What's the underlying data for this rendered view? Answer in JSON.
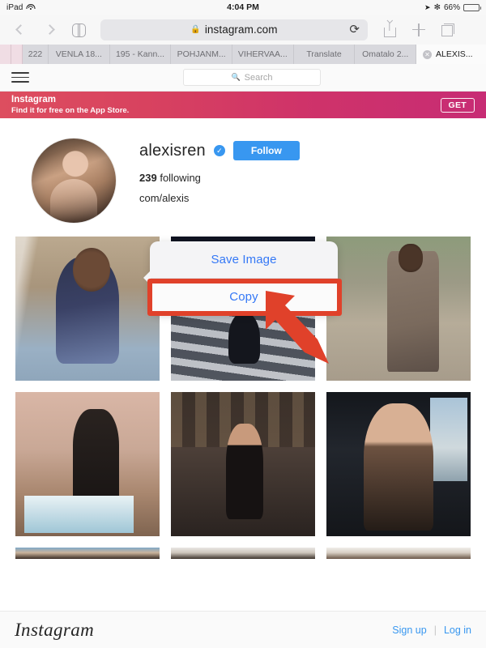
{
  "status_bar": {
    "device": "iPad",
    "wifi_icon": "wifi-icon",
    "time": "4:04 PM",
    "location_icon": "location-arrow-icon",
    "bluetooth_icon": "bluetooth-icon",
    "battery_percent": "66%",
    "battery_icon": "battery-icon"
  },
  "browser": {
    "back_icon": "chevron-left-icon",
    "forward_icon": "chevron-right-icon",
    "bookmarks_icon": "book-icon",
    "lock_icon": "lock-icon",
    "url": "instagram.com",
    "reload_icon": "reload-icon",
    "share_icon": "share-icon",
    "new_tab_icon": "plus-icon",
    "tabs_icon": "tabs-overview-icon",
    "tabs": [
      {
        "label": "222",
        "active": false,
        "style": "narrow"
      },
      {
        "label": "VENLA 18...",
        "active": false,
        "style": "normal"
      },
      {
        "label": "195 - Kann...",
        "active": false,
        "style": "normal"
      },
      {
        "label": "POHJANM...",
        "active": false,
        "style": "normal"
      },
      {
        "label": "VIHERVAA...",
        "active": false,
        "style": "normal"
      },
      {
        "label": "Translate",
        "active": false,
        "style": "normal"
      },
      {
        "label": "Omatalo 2...",
        "active": false,
        "style": "normal"
      },
      {
        "label": "ALEXIS...",
        "active": true,
        "style": "normal",
        "close_icon": "close-icon"
      }
    ]
  },
  "instagram_header": {
    "menu_icon": "hamburger-menu-icon",
    "search_icon": "search-icon",
    "search_placeholder": "Search"
  },
  "app_banner": {
    "title": "Instagram",
    "subtitle": "Find it for free on the App Store.",
    "cta_label": "GET"
  },
  "profile": {
    "avatar_name": "profile-avatar",
    "username": "alexisren",
    "verified_icon": "verified-badge-icon",
    "follow_label": "Follow",
    "following_count": "239",
    "following_label": "following",
    "link": "com/alexis"
  },
  "context_menu": {
    "items": [
      {
        "label": "Save Image",
        "name": "save-image-menu-item"
      },
      {
        "label": "Copy",
        "name": "copy-menu-item"
      }
    ],
    "highlight_color": "#e0412a"
  },
  "photo_grid": {
    "rows": [
      [
        {
          "name": "photo-1",
          "art": "p1"
        },
        {
          "name": "photo-2",
          "art": "p2"
        },
        {
          "name": "photo-3",
          "art": "p3"
        }
      ],
      [
        {
          "name": "photo-4",
          "art": "p4"
        },
        {
          "name": "photo-5",
          "art": "p5"
        },
        {
          "name": "photo-6",
          "art": "p6"
        }
      ],
      [
        {
          "name": "photo-7",
          "art": "p7"
        },
        {
          "name": "photo-8",
          "art": "p8"
        },
        {
          "name": "photo-9",
          "art": "p9"
        }
      ]
    ]
  },
  "footer": {
    "logo": "Instagram",
    "sign_up_label": "Sign up",
    "separator": "|",
    "log_in_label": "Log in",
    "link_color": "#3897f0"
  }
}
